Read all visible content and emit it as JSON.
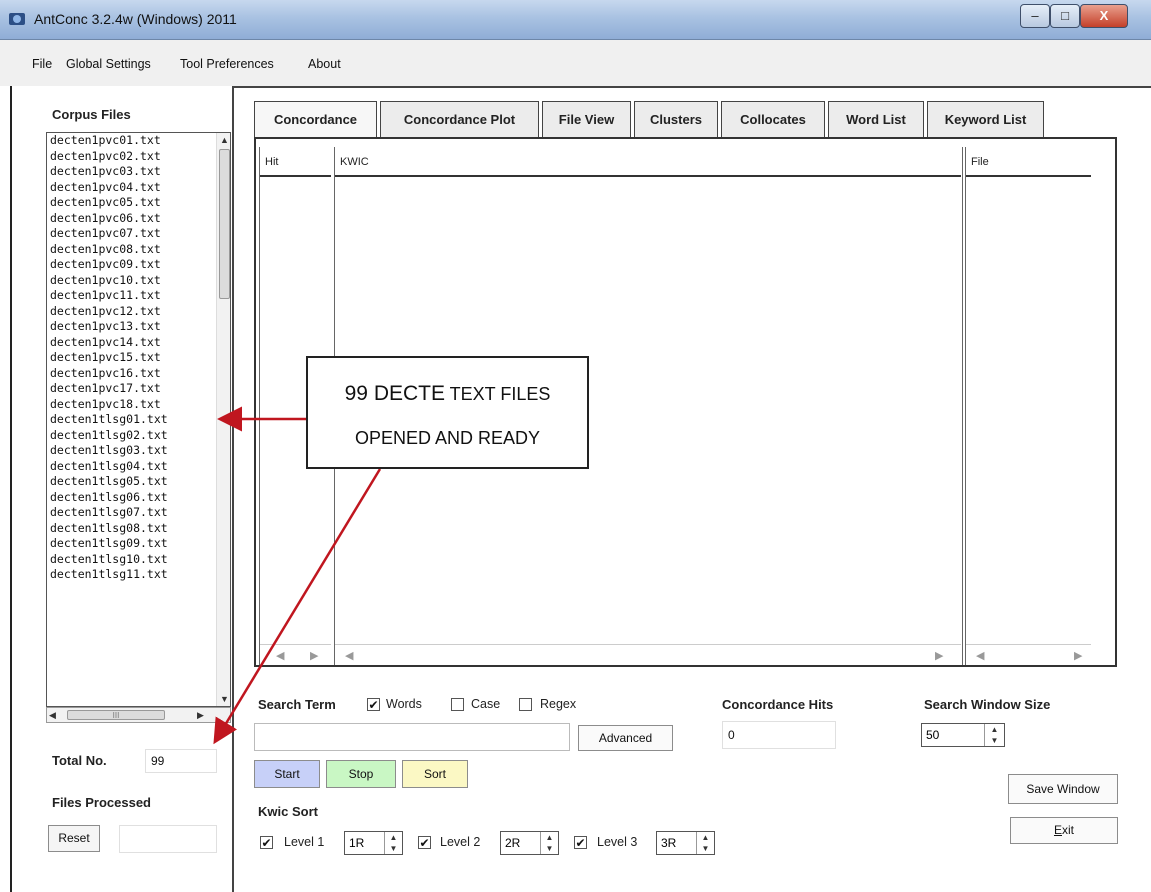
{
  "window": {
    "title": "AntConc 3.2.4w (Windows) 2011",
    "controls": {
      "minimize": "–",
      "maximize": "□",
      "close": "X"
    }
  },
  "menu": [
    "File",
    "Global Settings",
    "Tool Preferences",
    "About"
  ],
  "left_panel": {
    "corpus_files_label": "Corpus Files",
    "files": [
      "decten1pvc01.txt",
      "decten1pvc02.txt",
      "decten1pvc03.txt",
      "decten1pvc04.txt",
      "decten1pvc05.txt",
      "decten1pvc06.txt",
      "decten1pvc07.txt",
      "decten1pvc08.txt",
      "decten1pvc09.txt",
      "decten1pvc10.txt",
      "decten1pvc11.txt",
      "decten1pvc12.txt",
      "decten1pvc13.txt",
      "decten1pvc14.txt",
      "decten1pvc15.txt",
      "decten1pvc16.txt",
      "decten1pvc17.txt",
      "decten1pvc18.txt",
      "decten1tlsg01.txt",
      "decten1tlsg02.txt",
      "decten1tlsg03.txt",
      "decten1tlsg04.txt",
      "decten1tlsg05.txt",
      "decten1tlsg06.txt",
      "decten1tlsg07.txt",
      "decten1tlsg08.txt",
      "decten1tlsg09.txt",
      "decten1tlsg10.txt",
      "decten1tlsg11.txt"
    ],
    "hscroll_grip": "III",
    "total_no_label": "Total No.",
    "total_no_value": "99",
    "files_processed_label": "Files Processed",
    "reset_label": "Reset",
    "files_processed_value": ""
  },
  "tabs": [
    "Concordance",
    "Concordance Plot",
    "File View",
    "Clusters",
    "Collocates",
    "Word List",
    "Keyword List"
  ],
  "active_tab": "Concordance",
  "results": {
    "columns": [
      "Hit",
      "KWIC",
      "File"
    ]
  },
  "search": {
    "search_term_label": "Search Term",
    "words_label": "Words",
    "words_checked": true,
    "case_label": "Case",
    "case_checked": false,
    "regex_label": "Regex",
    "regex_checked": false,
    "query_value": "",
    "advanced_label": "Advanced",
    "start_label": "Start",
    "stop_label": "Stop",
    "sort_label": "Sort",
    "start_color": "#c7d0f8",
    "stop_color": "#c9f7c4",
    "sort_color": "#fbf8c4"
  },
  "hits": {
    "label": "Concordance Hits",
    "value": "0"
  },
  "window_size": {
    "label": "Search Window Size",
    "value": "50"
  },
  "kwic_sort": {
    "label": "Kwic Sort",
    "levels": [
      {
        "label": "Level 1",
        "checked": true,
        "value": "1R"
      },
      {
        "label": "Level 2",
        "checked": true,
        "value": "2R"
      },
      {
        "label": "Level 3",
        "checked": true,
        "value": "3R"
      }
    ]
  },
  "actions": {
    "save_window": "Save Window",
    "exit": "Exit"
  },
  "callout": {
    "line1_big": "99 DECTE",
    "line1_small": " TEXT FILES",
    "line2": "OPENED AND READY",
    "arrow_color": "#c0161f"
  }
}
